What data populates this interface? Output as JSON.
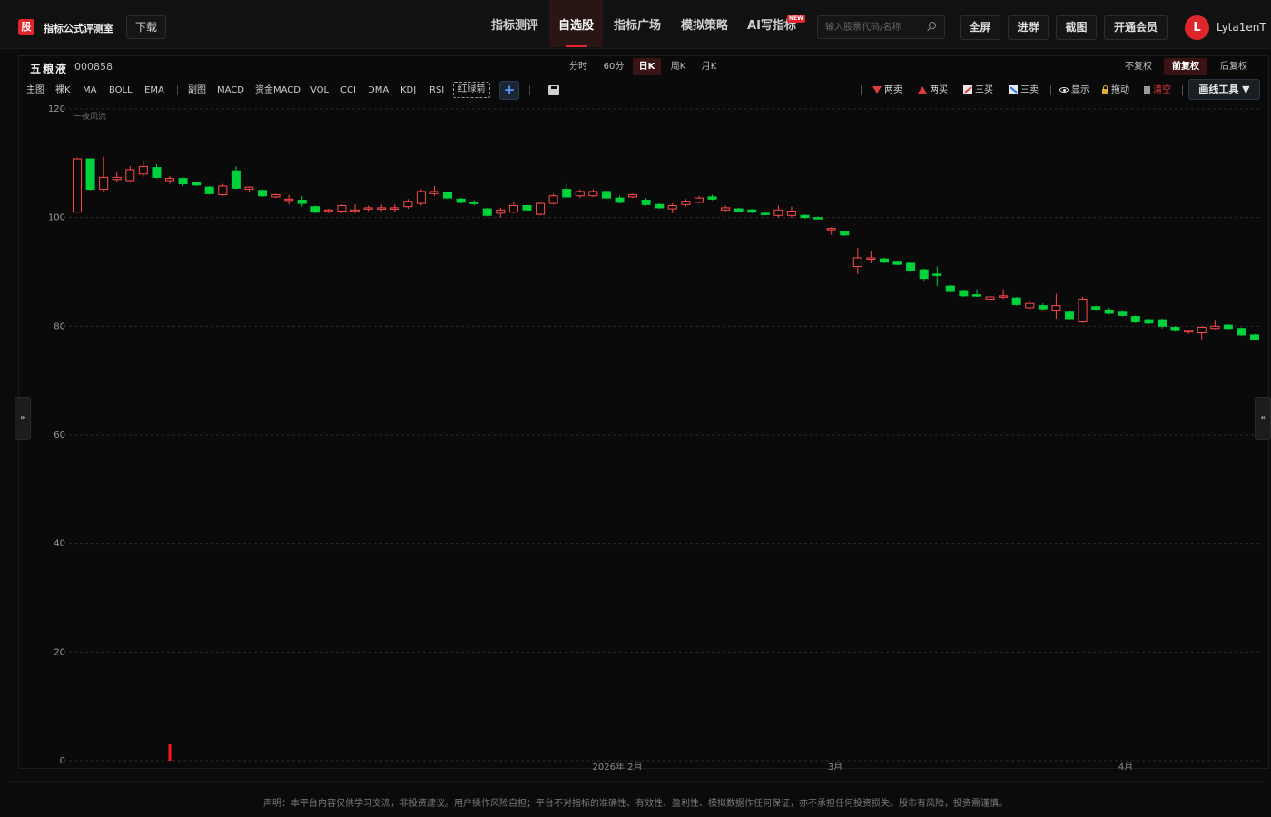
{
  "header": {
    "logo_char": "股",
    "brand": "指标公式评测室",
    "download": "下载",
    "nav": [
      {
        "label": "指标测评",
        "active": false
      },
      {
        "label": "自选股",
        "active": true
      },
      {
        "label": "指标广场",
        "active": false
      },
      {
        "label": "模拟策略",
        "active": false
      },
      {
        "label": "AI写指标",
        "active": false
      }
    ],
    "new_badge": "NEW",
    "search_placeholder": "输入股票代码/名称",
    "buttons": [
      "全屏",
      "进群",
      "截图",
      "开通会员"
    ],
    "avatar_letter": "L",
    "username": "Lyta1enT"
  },
  "stock": {
    "name": "五粮液",
    "code": "000858"
  },
  "periods": [
    {
      "label": "分时",
      "active": false
    },
    {
      "label": "60分",
      "active": false
    },
    {
      "label": "日K",
      "active": true
    },
    {
      "label": "周K",
      "active": false
    },
    {
      "label": "月K",
      "active": false
    }
  ],
  "adjust": [
    {
      "label": "不复权",
      "active": false
    },
    {
      "label": "前复权",
      "active": true
    },
    {
      "label": "后复权",
      "active": false
    }
  ],
  "indicators_main": [
    "主图",
    "裸K",
    "MA",
    "BOLL",
    "EMA"
  ],
  "indicators_sub": [
    "副图",
    "MACD",
    "资金MACD",
    "VOL",
    "CCI",
    "DMA",
    "KDJ",
    "RSI"
  ],
  "indicator_custom": "红绿箭",
  "plus": "+",
  "tools": {
    "two_sell": "两卖",
    "two_buy": "两买",
    "three_buy": "三买",
    "three_sell": "三卖",
    "show": "显示",
    "drag": "拖动",
    "clear": "清空",
    "draw_tools": "画线工具 ▼"
  },
  "side": {
    "left": "»",
    "right": "«"
  },
  "chart_data": {
    "type": "candlestick",
    "legend_label": "一夜风流",
    "ylim": [
      0,
      120
    ],
    "y_ticks": [
      0,
      20,
      40,
      60,
      80,
      100,
      120
    ],
    "x_labels": [
      "2026年 2月",
      "3月",
      "4月"
    ],
    "grid": true,
    "bullish_color": "#ff4a4a",
    "bearish_color": "#00d23c",
    "candles": [
      {
        "o": 101.0,
        "h": 111.0,
        "l": 101.0,
        "c": 110.8
      },
      {
        "o": 110.8,
        "h": 110.8,
        "l": 105.0,
        "c": 105.2
      },
      {
        "o": 105.2,
        "h": 111.2,
        "l": 104.8,
        "c": 107.4
      },
      {
        "o": 107.0,
        "h": 108.5,
        "l": 106.5,
        "c": 107.4
      },
      {
        "o": 106.8,
        "h": 109.5,
        "l": 106.6,
        "c": 108.8
      },
      {
        "o": 108.0,
        "h": 110.5,
        "l": 107.5,
        "c": 109.4
      },
      {
        "o": 109.2,
        "h": 109.8,
        "l": 107.2,
        "c": 107.4
      },
      {
        "o": 106.8,
        "h": 107.6,
        "l": 106.2,
        "c": 107.2
      },
      {
        "o": 107.2,
        "h": 107.4,
        "l": 105.8,
        "c": 106.2
      },
      {
        "o": 106.4,
        "h": 106.6,
        "l": 105.8,
        "c": 106.0
      },
      {
        "o": 105.6,
        "h": 105.8,
        "l": 104.2,
        "c": 104.4
      },
      {
        "o": 104.2,
        "h": 106.2,
        "l": 104.0,
        "c": 105.8
      },
      {
        "o": 108.6,
        "h": 109.4,
        "l": 105.2,
        "c": 105.4
      },
      {
        "o": 105.2,
        "h": 105.8,
        "l": 104.6,
        "c": 105.6
      },
      {
        "o": 105.0,
        "h": 105.2,
        "l": 103.8,
        "c": 104.0
      },
      {
        "o": 103.8,
        "h": 104.4,
        "l": 103.6,
        "c": 104.2
      },
      {
        "o": 103.4,
        "h": 104.2,
        "l": 102.4,
        "c": 103.4
      },
      {
        "o": 103.2,
        "h": 104.0,
        "l": 102.0,
        "c": 102.6
      },
      {
        "o": 102.0,
        "h": 102.2,
        "l": 100.8,
        "c": 101.0
      },
      {
        "o": 101.2,
        "h": 101.6,
        "l": 100.8,
        "c": 101.4
      },
      {
        "o": 101.2,
        "h": 102.4,
        "l": 100.8,
        "c": 102.2
      },
      {
        "o": 101.2,
        "h": 102.4,
        "l": 100.8,
        "c": 101.4
      },
      {
        "o": 101.6,
        "h": 102.2,
        "l": 101.2,
        "c": 101.8
      },
      {
        "o": 101.6,
        "h": 102.4,
        "l": 101.2,
        "c": 101.8
      },
      {
        "o": 101.6,
        "h": 102.4,
        "l": 101.0,
        "c": 101.8
      },
      {
        "o": 102.0,
        "h": 103.4,
        "l": 101.6,
        "c": 103.0
      },
      {
        "o": 102.6,
        "h": 105.2,
        "l": 102.2,
        "c": 104.8
      },
      {
        "o": 104.4,
        "h": 105.8,
        "l": 104.0,
        "c": 104.8
      },
      {
        "o": 104.6,
        "h": 104.6,
        "l": 103.4,
        "c": 103.6
      },
      {
        "o": 103.4,
        "h": 103.6,
        "l": 102.6,
        "c": 102.8
      },
      {
        "o": 102.8,
        "h": 103.2,
        "l": 102.2,
        "c": 102.6
      },
      {
        "o": 101.6,
        "h": 101.8,
        "l": 100.2,
        "c": 100.4
      },
      {
        "o": 100.8,
        "h": 101.8,
        "l": 100.0,
        "c": 101.4
      },
      {
        "o": 101.0,
        "h": 102.8,
        "l": 100.8,
        "c": 102.2
      },
      {
        "o": 102.2,
        "h": 102.6,
        "l": 101.0,
        "c": 101.4
      },
      {
        "o": 100.6,
        "h": 102.8,
        "l": 100.4,
        "c": 102.6
      },
      {
        "o": 102.6,
        "h": 104.4,
        "l": 102.4,
        "c": 104.0
      },
      {
        "o": 105.2,
        "h": 106.2,
        "l": 103.6,
        "c": 103.8
      },
      {
        "o": 104.0,
        "h": 105.2,
        "l": 103.6,
        "c": 104.8
      },
      {
        "o": 104.0,
        "h": 105.2,
        "l": 103.8,
        "c": 104.8
      },
      {
        "o": 104.8,
        "h": 105.0,
        "l": 103.4,
        "c": 103.6
      },
      {
        "o": 103.6,
        "h": 104.0,
        "l": 102.6,
        "c": 102.8
      },
      {
        "o": 103.8,
        "h": 104.4,
        "l": 103.6,
        "c": 104.2
      },
      {
        "o": 103.2,
        "h": 103.6,
        "l": 102.2,
        "c": 102.4
      },
      {
        "o": 102.4,
        "h": 102.6,
        "l": 101.6,
        "c": 101.8
      },
      {
        "o": 101.6,
        "h": 102.6,
        "l": 100.8,
        "c": 102.2
      },
      {
        "o": 102.4,
        "h": 103.4,
        "l": 102.0,
        "c": 103.0
      },
      {
        "o": 102.8,
        "h": 104.0,
        "l": 102.6,
        "c": 103.6
      },
      {
        "o": 103.8,
        "h": 104.2,
        "l": 103.2,
        "c": 103.4
      },
      {
        "o": 101.4,
        "h": 102.2,
        "l": 101.0,
        "c": 101.8
      },
      {
        "o": 101.6,
        "h": 101.8,
        "l": 101.0,
        "c": 101.2
      },
      {
        "o": 101.4,
        "h": 101.6,
        "l": 100.8,
        "c": 101.0
      },
      {
        "o": 100.8,
        "h": 101.0,
        "l": 100.4,
        "c": 100.6
      },
      {
        "o": 100.4,
        "h": 102.2,
        "l": 100.0,
        "c": 101.4
      },
      {
        "o": 100.4,
        "h": 102.0,
        "l": 100.0,
        "c": 101.2
      },
      {
        "o": 100.4,
        "h": 100.6,
        "l": 99.8,
        "c": 100.0
      },
      {
        "o": 100.0,
        "h": 100.2,
        "l": 99.8,
        "c": 99.9
      },
      {
        "o": 97.8,
        "h": 98.2,
        "l": 96.8,
        "c": 98.0
      },
      {
        "o": 97.4,
        "h": 97.6,
        "l": 96.6,
        "c": 96.8
      },
      {
        "o": 91.0,
        "h": 94.4,
        "l": 89.6,
        "c": 92.6
      },
      {
        "o": 92.4,
        "h": 93.8,
        "l": 91.6,
        "c": 92.6
      },
      {
        "o": 92.4,
        "h": 92.6,
        "l": 91.6,
        "c": 91.8
      },
      {
        "o": 91.8,
        "h": 92.0,
        "l": 91.2,
        "c": 91.4
      },
      {
        "o": 91.6,
        "h": 91.8,
        "l": 89.8,
        "c": 90.2
      },
      {
        "o": 90.4,
        "h": 90.6,
        "l": 88.4,
        "c": 88.8
      },
      {
        "o": 89.6,
        "h": 91.0,
        "l": 87.4,
        "c": 89.4
      },
      {
        "o": 87.4,
        "h": 87.6,
        "l": 86.2,
        "c": 86.4
      },
      {
        "o": 86.4,
        "h": 86.6,
        "l": 85.4,
        "c": 85.6
      },
      {
        "o": 85.8,
        "h": 86.8,
        "l": 85.4,
        "c": 85.6
      },
      {
        "o": 85.0,
        "h": 85.6,
        "l": 84.6,
        "c": 85.4
      },
      {
        "o": 85.4,
        "h": 86.8,
        "l": 85.0,
        "c": 85.6
      },
      {
        "o": 85.2,
        "h": 85.4,
        "l": 83.8,
        "c": 84.0
      },
      {
        "o": 83.4,
        "h": 84.8,
        "l": 83.0,
        "c": 84.2
      },
      {
        "o": 83.8,
        "h": 84.2,
        "l": 83.0,
        "c": 83.2
      },
      {
        "o": 82.8,
        "h": 86.0,
        "l": 81.4,
        "c": 83.8
      },
      {
        "o": 82.6,
        "h": 82.8,
        "l": 81.2,
        "c": 81.4
      },
      {
        "o": 80.8,
        "h": 85.4,
        "l": 80.6,
        "c": 85.0
      },
      {
        "o": 83.6,
        "h": 83.8,
        "l": 82.8,
        "c": 83.0
      },
      {
        "o": 83.0,
        "h": 83.4,
        "l": 82.2,
        "c": 82.4
      },
      {
        "o": 82.6,
        "h": 82.8,
        "l": 81.8,
        "c": 82.0
      },
      {
        "o": 81.8,
        "h": 82.0,
        "l": 80.6,
        "c": 80.8
      },
      {
        "o": 81.2,
        "h": 81.4,
        "l": 80.4,
        "c": 80.6
      },
      {
        "o": 81.2,
        "h": 81.4,
        "l": 79.6,
        "c": 80.0
      },
      {
        "o": 79.8,
        "h": 80.0,
        "l": 79.0,
        "c": 79.2
      },
      {
        "o": 79.0,
        "h": 79.4,
        "l": 78.6,
        "c": 79.2
      },
      {
        "o": 78.8,
        "h": 80.0,
        "l": 77.6,
        "c": 79.8
      },
      {
        "o": 79.6,
        "h": 81.0,
        "l": 79.4,
        "c": 80.0
      },
      {
        "o": 80.2,
        "h": 80.4,
        "l": 79.4,
        "c": 79.6
      },
      {
        "o": 79.6,
        "h": 79.8,
        "l": 78.2,
        "c": 78.4
      },
      {
        "o": 78.4,
        "h": 78.6,
        "l": 77.4,
        "c": 77.6
      }
    ],
    "signals": [
      {
        "index": 7,
        "type": "buy",
        "value": 3
      }
    ]
  },
  "disclaimer": "声明：本平台内容仅供学习交流，非投资建议。用户操作风险自担；平台不对指标的准确性、有效性、盈利性、模拟数据作任何保证，亦不承担任何投资损失。股市有风险，投资需谨慎。"
}
